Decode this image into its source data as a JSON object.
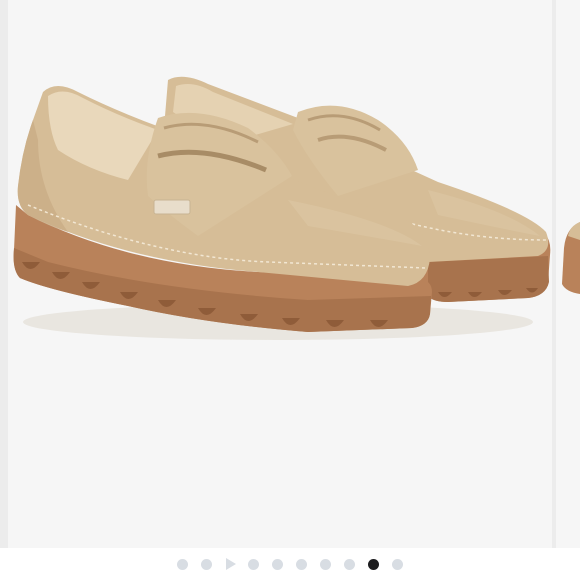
{
  "product_gallery": {
    "main_image_subject": "tan-suede-penny-loafers-pair",
    "colors": {
      "upper": "#d6bd97",
      "upper_shadow": "#bfa37c",
      "sole": "#b9825a",
      "sole_dark": "#9c6843",
      "background": "#f6f6f6",
      "dot_inactive": "#d8dde3",
      "dot_active": "#1d1d1f"
    },
    "pagination": {
      "total": 10,
      "current": 9,
      "video_slide": 3
    }
  }
}
